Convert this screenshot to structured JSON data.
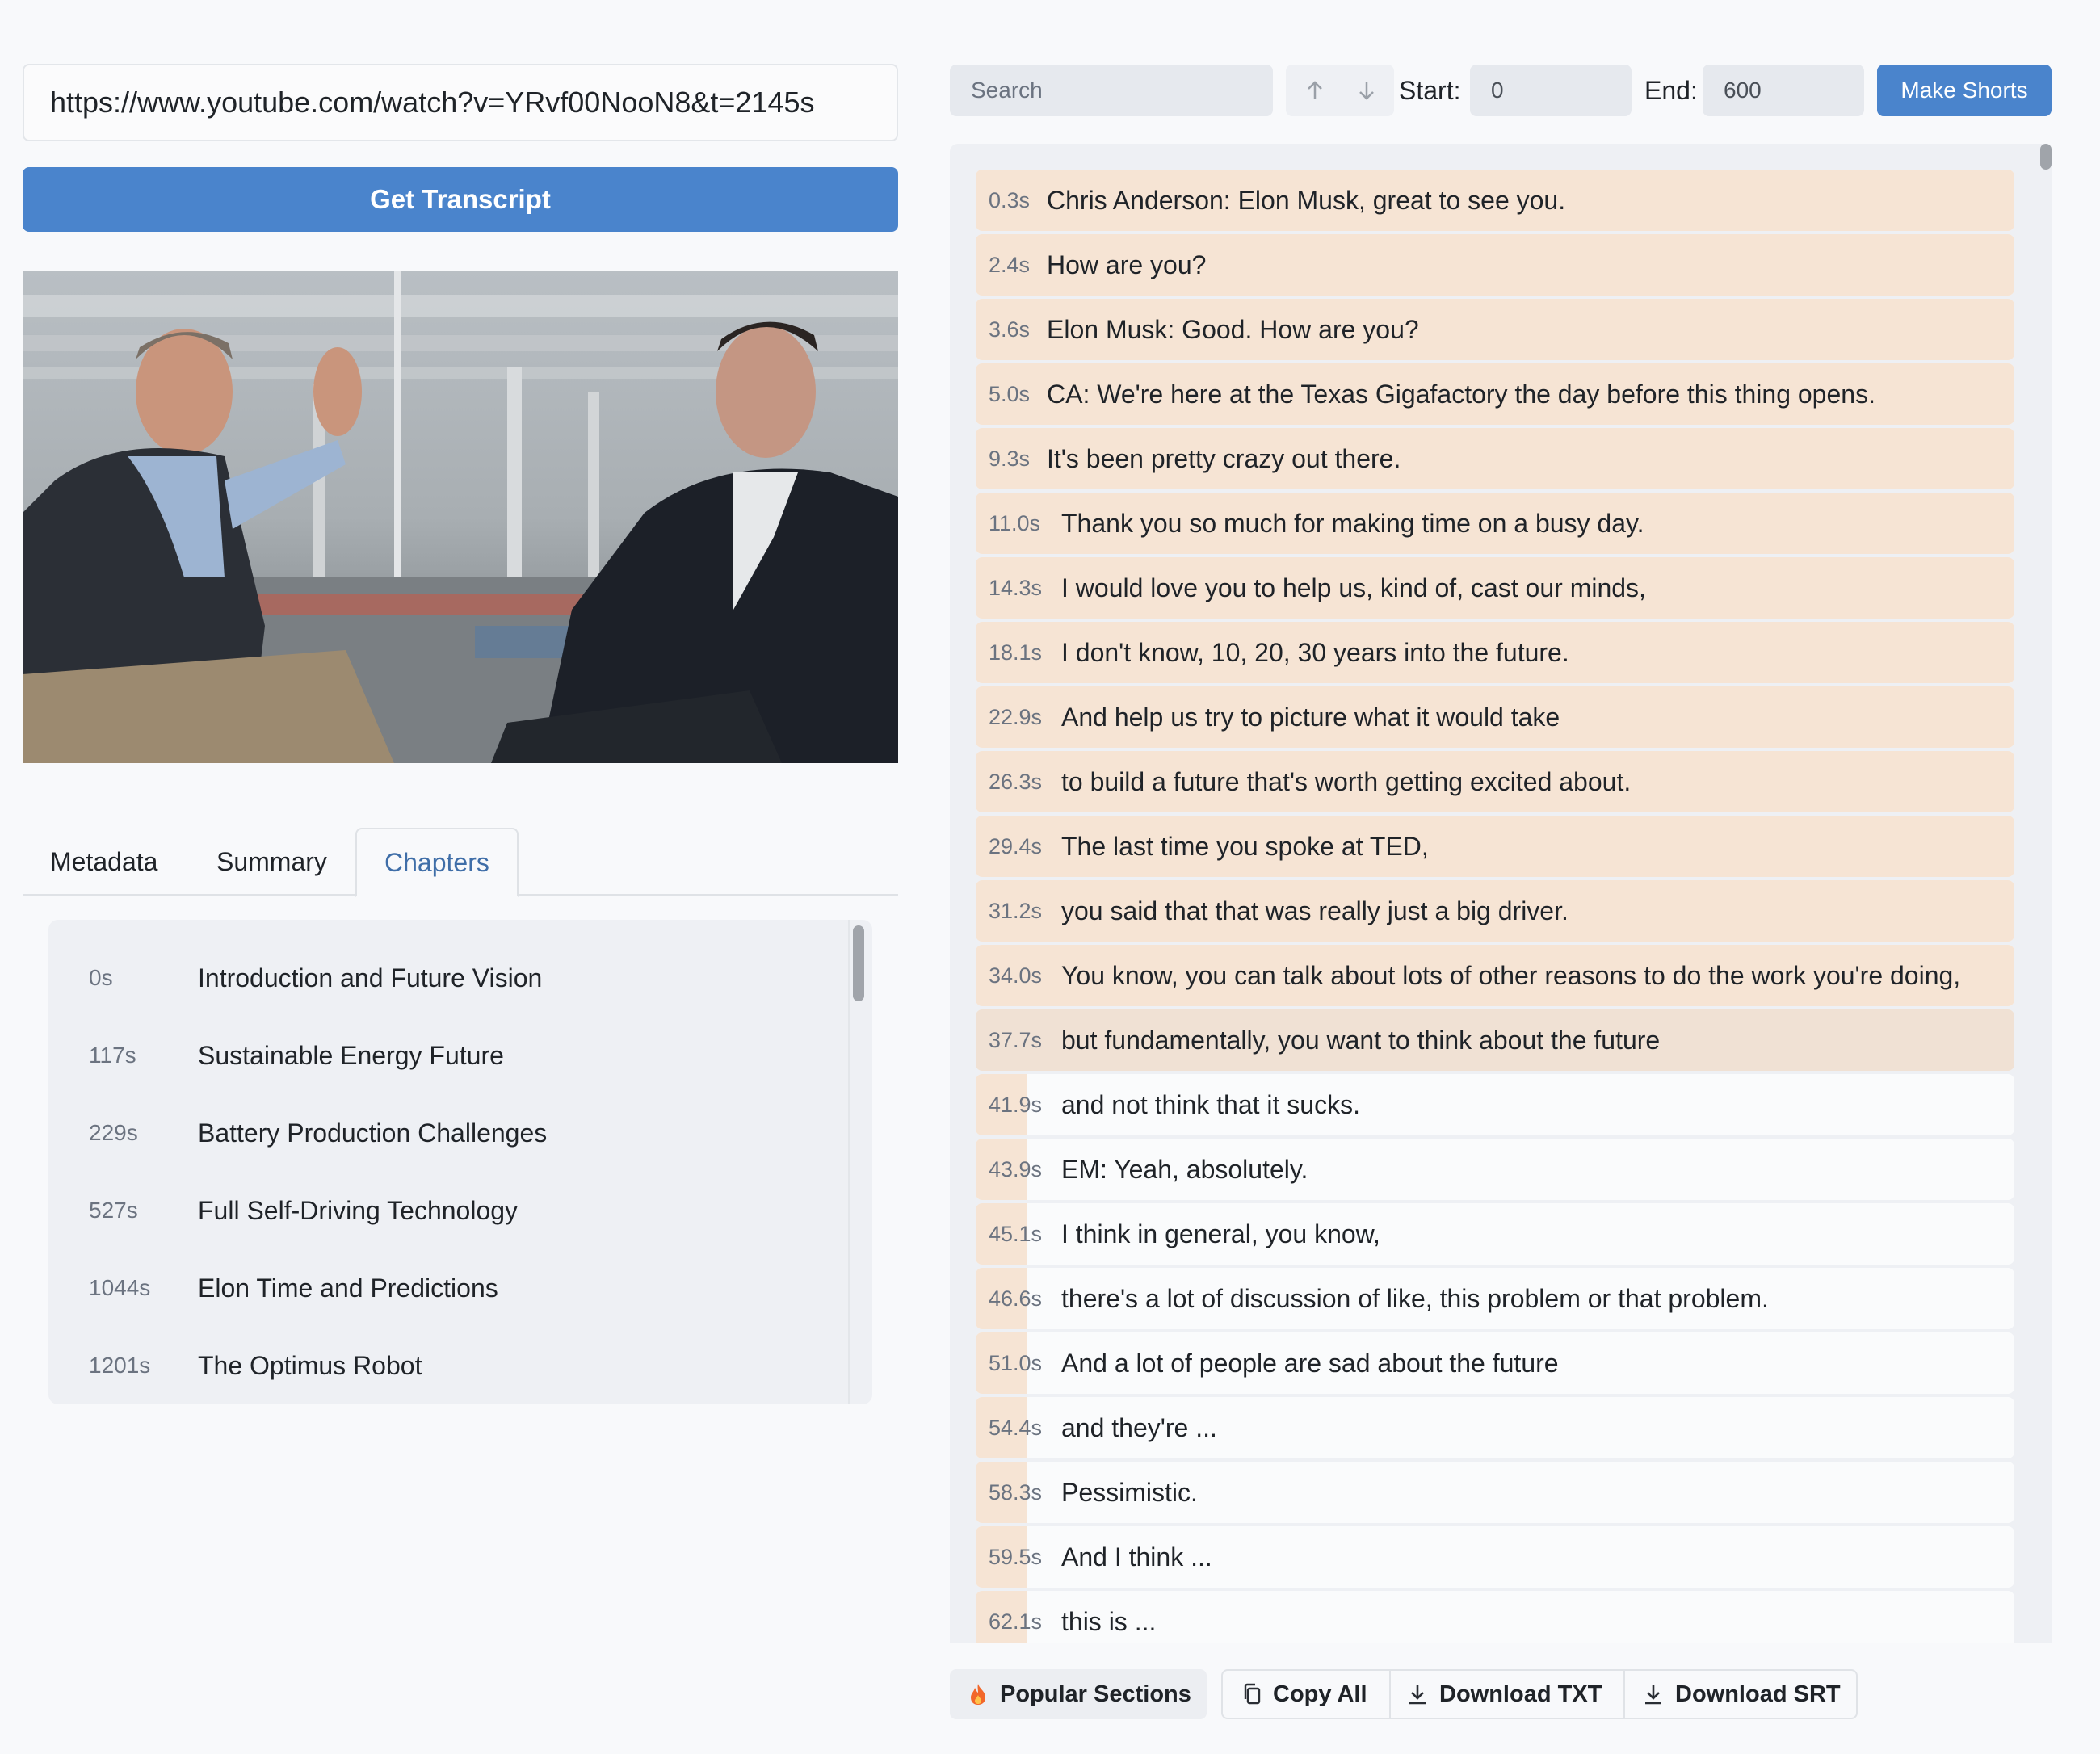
{
  "url_input": {
    "value": "https://www.youtube.com/watch?v=YRvf00NooN8&t=2145s"
  },
  "get_transcript_label": "Get Transcript",
  "tabs": [
    {
      "label": "Metadata",
      "active": false
    },
    {
      "label": "Summary",
      "active": false
    },
    {
      "label": "Chapters",
      "active": true
    }
  ],
  "chapters": [
    {
      "time": "0s",
      "title": "Introduction and Future Vision"
    },
    {
      "time": "117s",
      "title": "Sustainable Energy Future"
    },
    {
      "time": "229s",
      "title": "Battery Production Challenges"
    },
    {
      "time": "527s",
      "title": "Full Self-Driving Technology"
    },
    {
      "time": "1044s",
      "title": "Elon Time and Predictions"
    },
    {
      "time": "1201s",
      "title": "The Optimus Robot"
    }
  ],
  "toolbar": {
    "search_placeholder": "Search",
    "up_icon": "arrow-up-icon",
    "down_icon": "arrow-down-icon",
    "start_label": "Start:",
    "start_value": "0",
    "end_label": "End:",
    "end_value": "600",
    "make_shorts_label": "Make Shorts"
  },
  "transcript": [
    {
      "time": "0.3s",
      "text": "Chris Anderson: Elon Musk, great to see you.",
      "heat": 1.0
    },
    {
      "time": "2.4s",
      "text": "How are you?",
      "heat": 1.0
    },
    {
      "time": "3.6s",
      "text": "Elon Musk: Good. How are you?",
      "heat": 1.0
    },
    {
      "time": "5.0s",
      "text": "CA: We're here at the Texas Gigafactory the day before this thing opens.",
      "heat": 1.0
    },
    {
      "time": "9.3s",
      "text": "It's been pretty crazy out there.",
      "heat": 1.0
    },
    {
      "time": "11.0s",
      "text": "Thank you so much for making time on a busy day.",
      "heat": 1.0
    },
    {
      "time": "14.3s",
      "text": "I would love you to help us, kind of, cast our minds,",
      "heat": 1.0
    },
    {
      "time": "18.1s",
      "text": "I don't know, 10, 20, 30 years into the future.",
      "heat": 1.0
    },
    {
      "time": "22.9s",
      "text": "And help us try to picture what it would take",
      "heat": 1.0
    },
    {
      "time": "26.3s",
      "text": "to build a future that's worth getting excited about.",
      "heat": 1.0
    },
    {
      "time": "29.4s",
      "text": "The last time you spoke at TED,",
      "heat": 1.0
    },
    {
      "time": "31.2s",
      "text": "you said that that was really just a big driver.",
      "heat": 1.0
    },
    {
      "time": "34.0s",
      "text": "You know, you can talk about lots of other reasons to do the work you're doing,",
      "heat": 1.0
    },
    {
      "time": "37.7s",
      "text": "but fundamentally, you want to think about the future",
      "heat": 1.0,
      "current": true
    },
    {
      "time": "41.9s",
      "text": "and not think that it sucks.",
      "heat": 0.05
    },
    {
      "time": "43.9s",
      "text": "EM: Yeah, absolutely.",
      "heat": 0.05
    },
    {
      "time": "45.1s",
      "text": "I think in general, you know,",
      "heat": 0.05
    },
    {
      "time": "46.6s",
      "text": "there's a lot of discussion of like, this problem or that problem.",
      "heat": 0.05
    },
    {
      "time": "51.0s",
      "text": "And a lot of people are sad about the future",
      "heat": 0.05
    },
    {
      "time": "54.4s",
      "text": "and they're ...",
      "heat": 0.05
    },
    {
      "time": "58.3s",
      "text": "Pessimistic.",
      "heat": 0.05
    },
    {
      "time": "59.5s",
      "text": "And I think ...",
      "heat": 0.05
    },
    {
      "time": "62.1s",
      "text": "this is ...",
      "heat": 0.05
    }
  ],
  "actions": {
    "popular_sections": "Popular Sections",
    "copy_all": "Copy All",
    "download_txt": "Download TXT",
    "download_srt": "Download SRT"
  },
  "colors": {
    "accent": "#4a84cc",
    "heat": "#f6e4d4",
    "current_segment": "#f0e1d4",
    "active_tab": "#3f6ea8"
  }
}
